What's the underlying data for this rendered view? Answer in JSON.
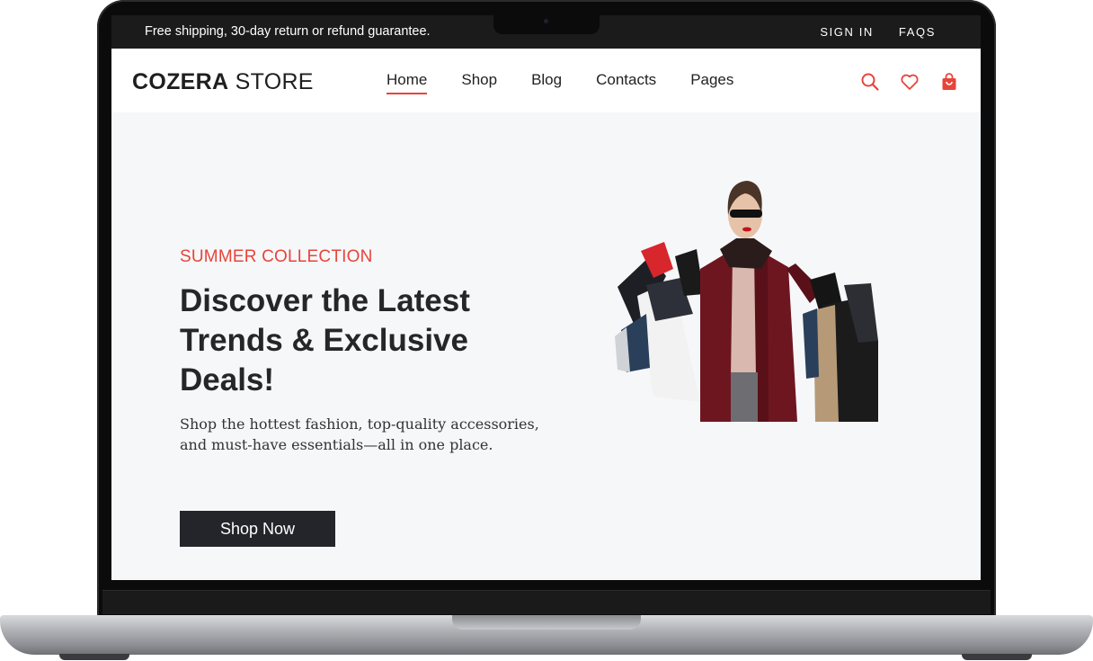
{
  "topbar": {
    "promo": "Free shipping, 30-day return or refund guarantee.",
    "links": [
      "SIGN IN",
      "FAQS"
    ]
  },
  "brand": {
    "bold": "COZERA",
    "light": "STORE"
  },
  "nav": {
    "items": [
      "Home",
      "Shop",
      "Blog",
      "Contacts",
      "Pages"
    ],
    "active": "Home"
  },
  "icons": [
    "search-icon",
    "heart-icon",
    "shopping-bag-icon"
  ],
  "hero": {
    "eyebrow": "SUMMER COLLECTION",
    "headline": "Discover the Latest Trends & Exclusive Deals!",
    "subtext": "Shop the hottest fashion, top-quality accessories, and must-have essentials—all in one place.",
    "cta": "Shop Now"
  },
  "colors": {
    "accent": "#e8443a",
    "dark": "#1b1b1b",
    "hero_bg": "#f6f7f9"
  }
}
